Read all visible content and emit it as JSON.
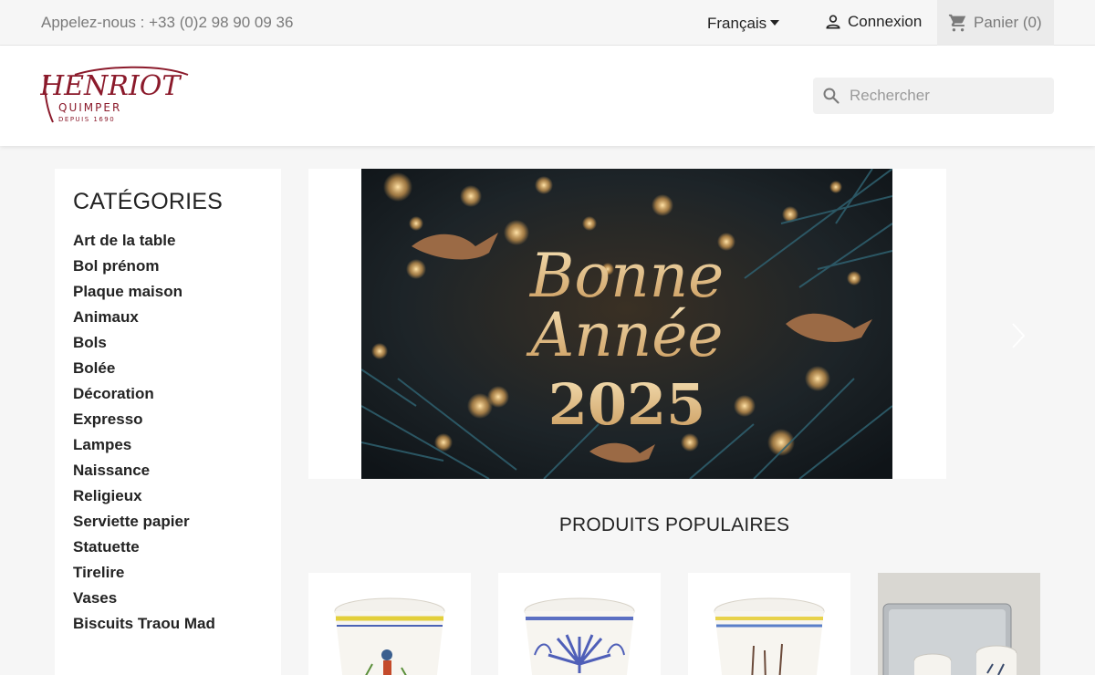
{
  "topbar": {
    "phone": "Appelez-nous : +33 (0)2 98 90 09 36",
    "language": "Français",
    "login": "Connexion",
    "cart": "Panier (0)"
  },
  "header": {
    "logo_text": "HENRIOT",
    "logo_sub": "QUIMPER",
    "logo_since": "DEPUIS 1690",
    "search_placeholder": "Rechercher"
  },
  "sidebar": {
    "title": "CATÉGORIES",
    "items": [
      {
        "label": "Art de la table"
      },
      {
        "label": "Bol prénom"
      },
      {
        "label": "Plaque maison"
      },
      {
        "label": "Animaux"
      },
      {
        "label": "Bols"
      },
      {
        "label": "Bolée"
      },
      {
        "label": "Décoration"
      },
      {
        "label": "Expresso"
      },
      {
        "label": "Lampes"
      },
      {
        "label": "Naissance"
      },
      {
        "label": "Religieux"
      },
      {
        "label": "Serviette papier"
      },
      {
        "label": "Statuette"
      },
      {
        "label": "Tirelire"
      },
      {
        "label": "Vases"
      },
      {
        "label": "Biscuits Traou Mad"
      }
    ]
  },
  "slider": {
    "line1": "Bonne",
    "line2": "Année",
    "line3": "2025"
  },
  "popular": {
    "title": "PRODUITS POPULAIRES"
  },
  "colors": {
    "brand": "#8b1a2b",
    "text": "#232323",
    "muted": "#7a7a7a",
    "background": "#f6f6f6"
  }
}
